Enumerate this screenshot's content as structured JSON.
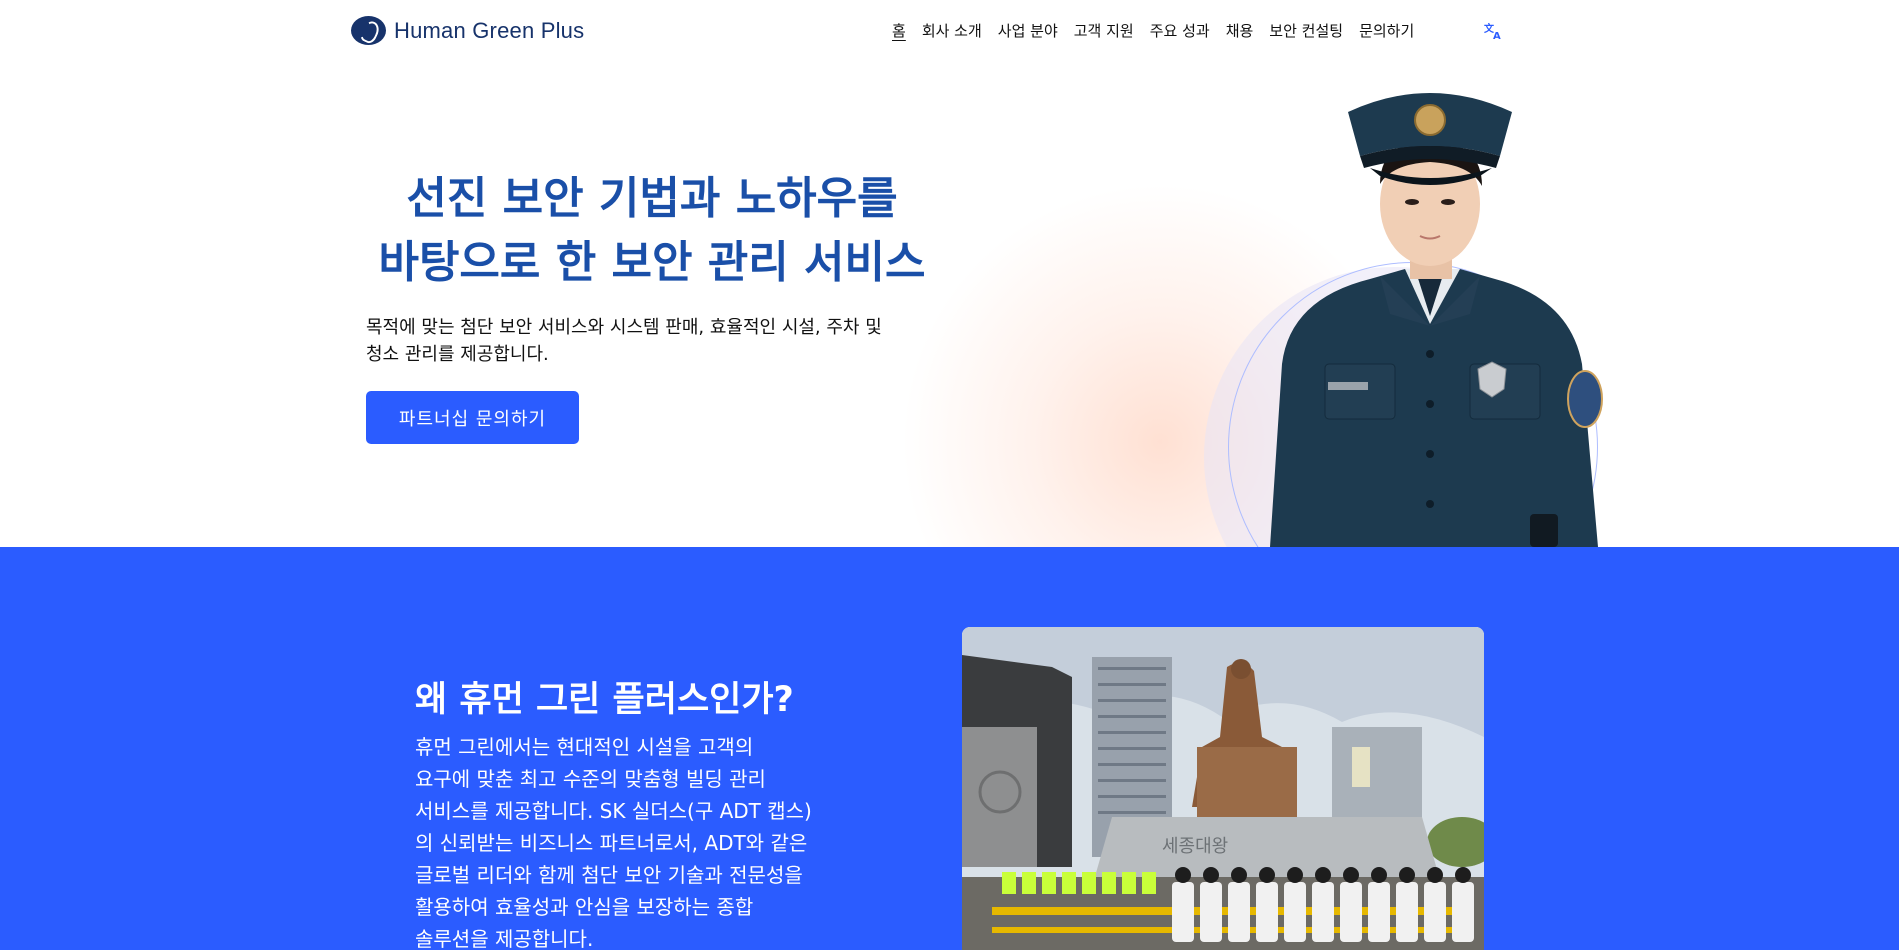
{
  "header": {
    "logo_text": "Human Green Plus",
    "nav": [
      {
        "label": "홈",
        "active": true
      },
      {
        "label": "회사 소개"
      },
      {
        "label": "사업 분야"
      },
      {
        "label": "고객 지원"
      },
      {
        "label": "주요 성과"
      },
      {
        "label": "채용"
      },
      {
        "label": "보안 컨설팅"
      },
      {
        "label": "문의하기"
      }
    ],
    "translate_icon": "translate-icon"
  },
  "hero": {
    "title_line1": "선진 보안 기법과 노하우를",
    "title_line2": "바탕으로 한 보안 관리 서비스",
    "subtitle_line1": "목적에 맞는 첨단 보안 서비스와 시스템 판매, 효율적인 시설, 주차 및",
    "subtitle_line2": "청소 관리를 제공합니다.",
    "cta_label": "파트너십 문의하기"
  },
  "why": {
    "title": "왜 휴먼 그린 플러스인가?",
    "body_lines": [
      "휴먼 그린에서는 현대적인 시설을 고객의",
      "요구에 맞춘 최고 수준의 맞춤형 빌딩 관리",
      "서비스를 제공합니다. SK 실더스(구 ADT 캡스)",
      "의 신뢰받는 비즈니스 파트너로서, ADT와 같은",
      "글로벌 리더와 함께 첨단 보안 기술과 전문성을",
      "활용하여 효율성과 안심을 보장하는 종합",
      "솔루션을 제공합니다."
    ],
    "photo_sign": "세종대왕"
  },
  "colors": {
    "brand_blue": "#2b5cff",
    "title_blue": "#1a4fa8",
    "logo_navy": "#17336b"
  }
}
